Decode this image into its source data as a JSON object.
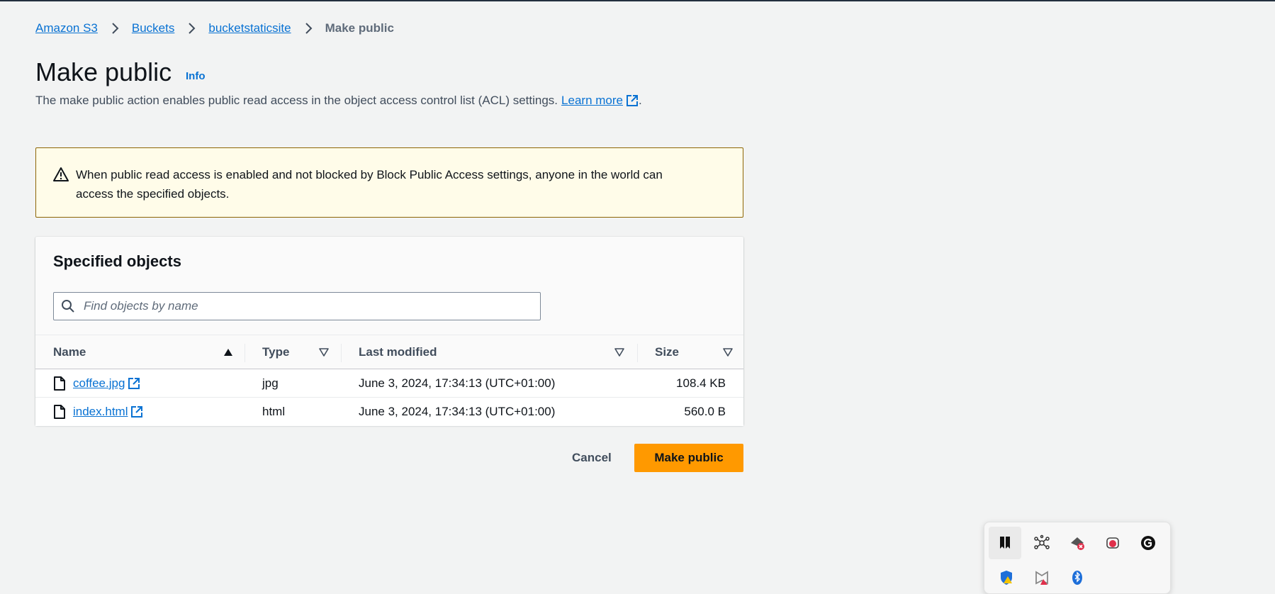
{
  "breadcrumb": {
    "items": [
      "Amazon S3",
      "Buckets",
      "bucketstaticsite"
    ],
    "current": "Make public"
  },
  "page": {
    "title": "Make public",
    "info_label": "Info",
    "description": "The make public action enables public read access in the object access control list (ACL) settings.",
    "learn_more": "Learn more",
    "period": "."
  },
  "warning": {
    "text": "When public read access is enabled and not blocked by Block Public Access settings, anyone in the world can access the specified objects."
  },
  "objects": {
    "header": "Specified objects",
    "search_placeholder": "Find objects by name",
    "columns": [
      "Name",
      "Type",
      "Last modified",
      "Size"
    ],
    "rows": [
      {
        "name": "coffee.jpg",
        "type": "jpg",
        "last_modified": "June 3, 2024, 17:34:13 (UTC+01:00)",
        "size": "108.4 KB"
      },
      {
        "name": "index.html",
        "type": "html",
        "last_modified": "June 3, 2024, 17:34:13 (UTC+01:00)",
        "size": "560.0 B"
      }
    ]
  },
  "actions": {
    "cancel": "Cancel",
    "confirm": "Make public"
  },
  "colors": {
    "link": "#0972d3",
    "primary": "#ff9900",
    "warning_bg": "#fffce9",
    "warning_border": "#8d6605",
    "background": "#f2f3f3"
  },
  "tray_icons": [
    "bookmark-icon",
    "network-icon",
    "blocked-app-icon",
    "cloud-app-icon",
    "grammarly-icon",
    "security-shield-icon",
    "mcafee-icon",
    "bluetooth-icon"
  ]
}
